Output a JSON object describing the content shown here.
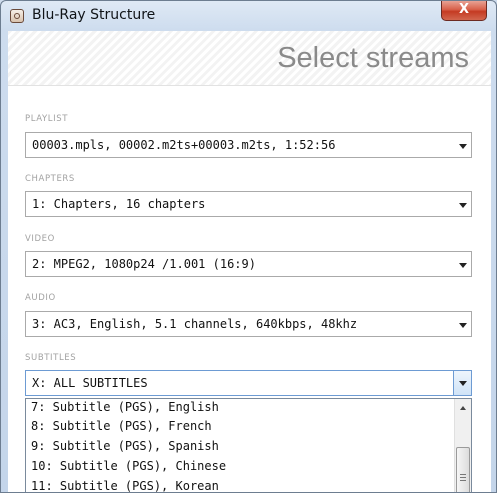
{
  "window": {
    "title": "Blu-Ray Structure",
    "close_glyph": "X",
    "app_icon": "bluray-disc-icon"
  },
  "header": {
    "heading": "Select streams"
  },
  "sections": {
    "playlist": {
      "label": "PLAYLIST",
      "value": "00003.mpls, 00002.m2ts+00003.m2ts, 1:52:56"
    },
    "chapters": {
      "label": "CHAPTERS",
      "value": "1: Chapters, 16 chapters"
    },
    "video": {
      "label": "VIDEO",
      "value": "2: MPEG2, 1080p24 /1.001 (16:9)"
    },
    "audio": {
      "label": "AUDIO",
      "value": "3: AC3, English, 5.1 channels, 640kbps, 48khz"
    },
    "subtitles": {
      "label": "SUBTITLES",
      "value": "X: ALL SUBTITLES"
    }
  },
  "subtitle_options": [
    "7: Subtitle (PGS), English",
    "8: Subtitle (PGS), French",
    "9: Subtitle (PGS), Spanish",
    "10: Subtitle (PGS), Chinese",
    "11: Subtitle (PGS), Korean"
  ]
}
